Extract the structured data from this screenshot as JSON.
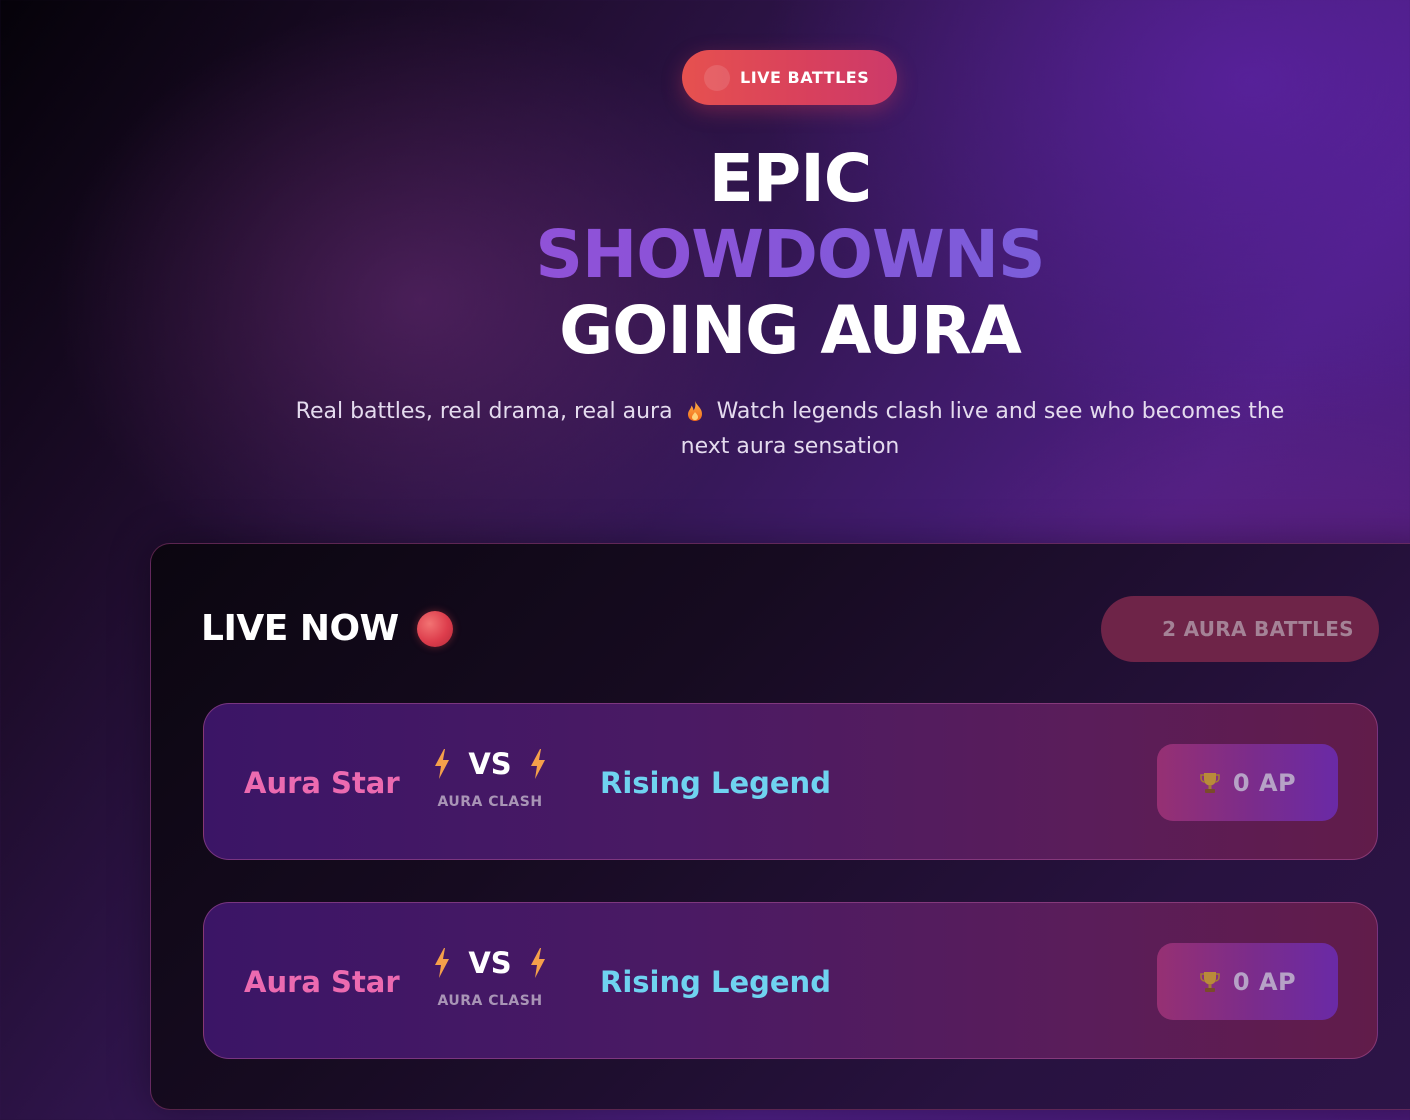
{
  "hero": {
    "badge_label": "LIVE BATTLES",
    "headline_line1": "EPIC",
    "headline_line2": "SHOWDOWNS",
    "headline_line3": "GOING AURA",
    "subtitle_part1": "Real battles, real drama, real aura",
    "subtitle_icon": "fire-icon",
    "subtitle_part2": "Watch legends clash live and see who becomes the next aura sensation"
  },
  "live_panel": {
    "title": "LIVE NOW",
    "live_indicator_icon": "red-dot",
    "battle_count_label": "2 AURA BATTLES",
    "battles": [
      {
        "player_a": "Aura Star",
        "vs_label": "VS",
        "mode_label": "AURA CLASH",
        "player_b": "Rising Legend",
        "points_label": "0 AP",
        "points_icon": "trophy-icon"
      },
      {
        "player_a": "Aura Star",
        "vs_label": "VS",
        "mode_label": "AURA CLASH",
        "player_b": "Rising Legend",
        "points_label": "0 AP",
        "points_icon": "trophy-icon"
      }
    ]
  },
  "colors": {
    "accent_pink": "#ec6ab0",
    "accent_cyan": "#6fd3f0",
    "headline_gradient_start": "#9f4fd4",
    "headline_gradient_end": "#6b68dc",
    "live_red": "#e6514f",
    "bolt_orange": "#f5a04a"
  }
}
